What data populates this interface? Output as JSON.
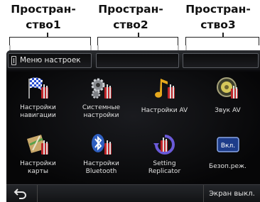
{
  "callouts": [
    {
      "line1": "Простран-",
      "line2": "ство1"
    },
    {
      "line1": "Простран-",
      "line2": "ство2"
    },
    {
      "line1": "Простран-",
      "line2": "ство3"
    }
  ],
  "title_bar": {
    "space1_label": "Меню настроек",
    "space2_label": "",
    "space3_label": ""
  },
  "tiles": [
    {
      "icon": "checkered-flag-icon",
      "line1": "Настройки",
      "line2": "навигации"
    },
    {
      "icon": "gears-icon",
      "line1": "Системные",
      "line2": "настройки"
    },
    {
      "icon": "music-note-icon",
      "line1": "Настройки AV",
      "line2": ""
    },
    {
      "icon": "speaker-icon",
      "line1": "Звук AV",
      "line2": ""
    },
    {
      "icon": "map-icon",
      "line1": "Настройки",
      "line2": "карты"
    },
    {
      "icon": "bluetooth-icon",
      "line1": "Настройки",
      "line2": "Bluetooth"
    },
    {
      "icon": "replicator-icon",
      "line1": "Setting",
      "line2": "Replicator"
    },
    {
      "icon": "safety-mode-icon",
      "icon_text": "Вкл.",
      "line1": "Безоп.реж.",
      "line2": ""
    }
  ],
  "bottom_bar": {
    "back_icon": "back-arrow-icon",
    "screen_off_label": "Экран выкл."
  },
  "colors": {
    "screen_bg": "#0a0a0c",
    "text": "#e2e2e2",
    "accent_red": "#c0262a",
    "callout_text": "#111111"
  }
}
